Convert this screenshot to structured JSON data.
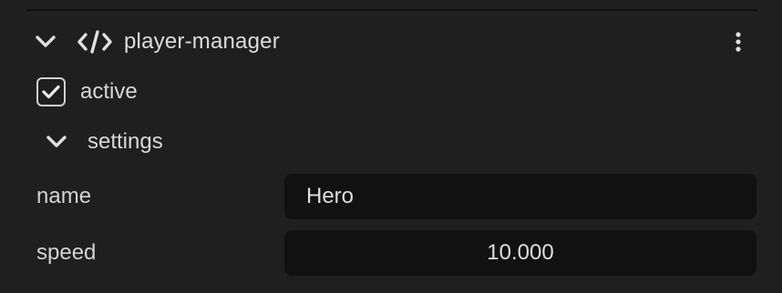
{
  "component": {
    "name": "player-manager",
    "collapse_icon": "chevron-down-icon",
    "type_icon": "code-icon",
    "menu_icon": "kebab-menu-icon"
  },
  "active": {
    "label": "active",
    "checked": true
  },
  "settings": {
    "label": "settings",
    "expanded": true,
    "fields": {
      "name": {
        "label": "name",
        "value": "Hero"
      },
      "speed": {
        "label": "speed",
        "value": "10.000"
      }
    }
  },
  "colors": {
    "background": "#1f1f1f",
    "field_background": "#111111",
    "text": "#d8d8d8",
    "icon": "#e0e0e0"
  }
}
